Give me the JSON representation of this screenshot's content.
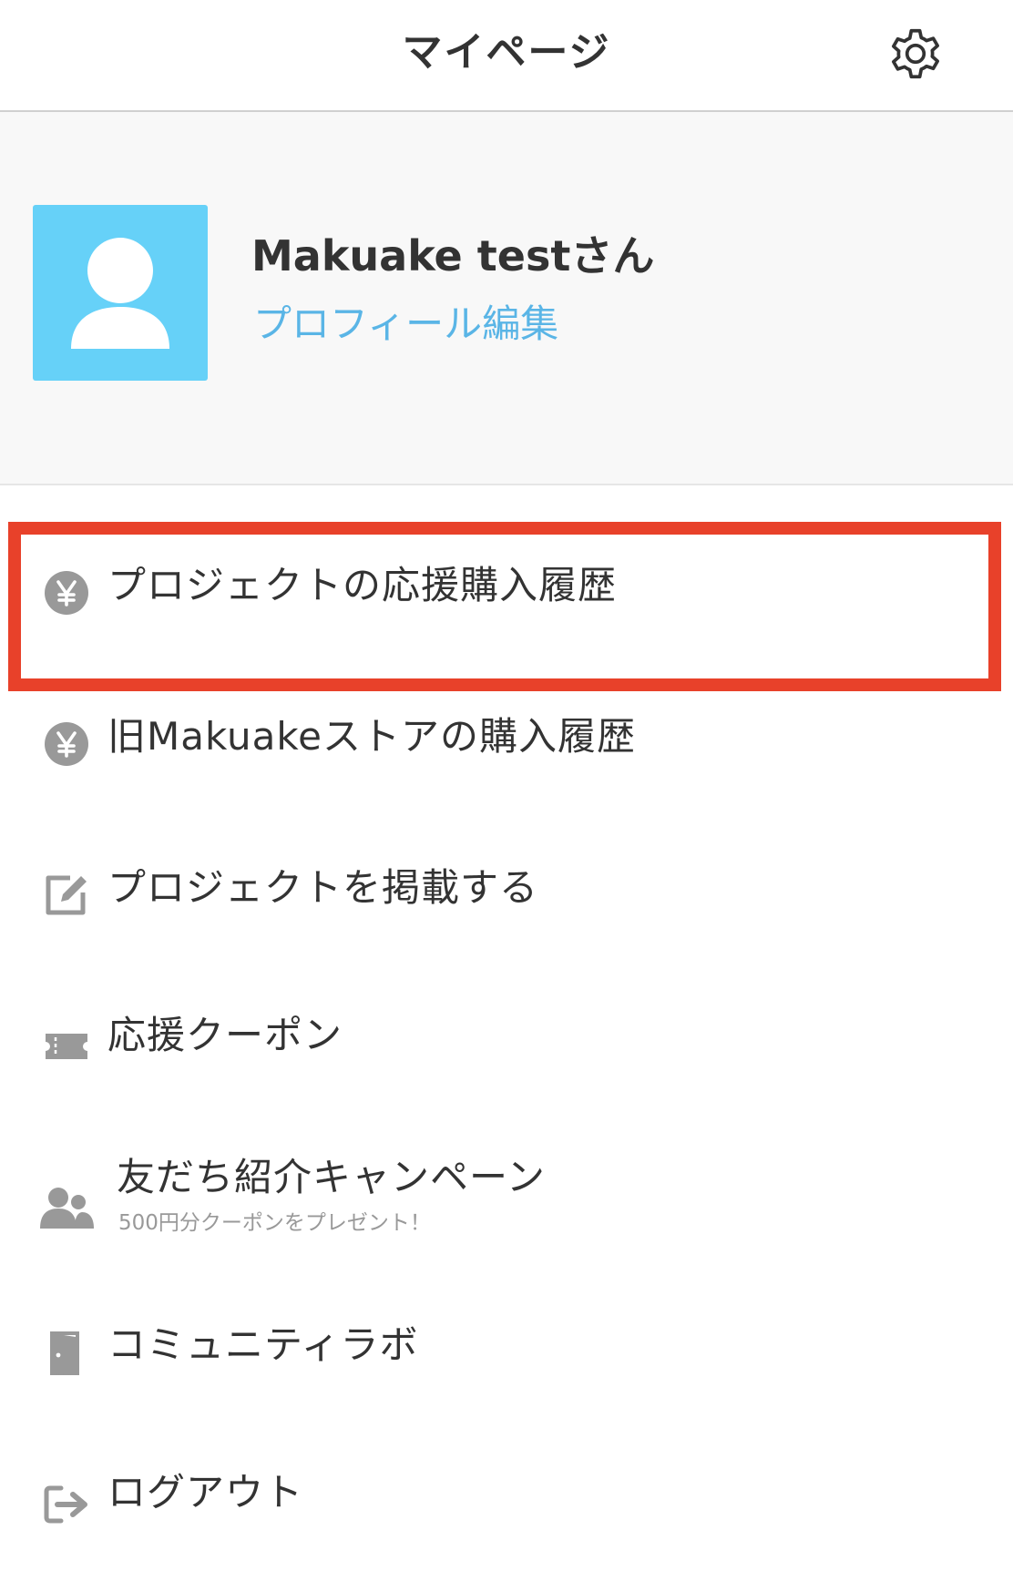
{
  "header": {
    "title": "マイページ",
    "settings_icon": "gear-icon"
  },
  "profile": {
    "user_name": "Makuake testさん",
    "edit_link": "プロフィール編集",
    "avatar_icon": "user-avatar-icon",
    "avatar_color": "#66d1f8",
    "link_color": "#5ab5e6"
  },
  "menu": {
    "items": [
      {
        "icon": "yen-circle-icon",
        "label": "プロジェクトの応援購入履歴",
        "highlighted": true
      },
      {
        "icon": "yen-circle-icon",
        "label": "旧Makuakeストアの購入履歴"
      },
      {
        "icon": "edit-icon",
        "label": "プロジェクトを掲載する"
      },
      {
        "icon": "ticket-icon",
        "label": "応援クーポン"
      },
      {
        "icon": "users-icon",
        "label": "友だち紹介キャンペーン",
        "sub": "500円分クーポンをプレゼント！"
      },
      {
        "icon": "door-icon",
        "label": "コミュニティラボ"
      },
      {
        "icon": "logout-icon",
        "label": "ログアウト"
      }
    ]
  },
  "colors": {
    "highlight": "#e8412a",
    "icon_gray": "#999999",
    "text": "#333333",
    "profile_bg": "#f8f8f8"
  }
}
